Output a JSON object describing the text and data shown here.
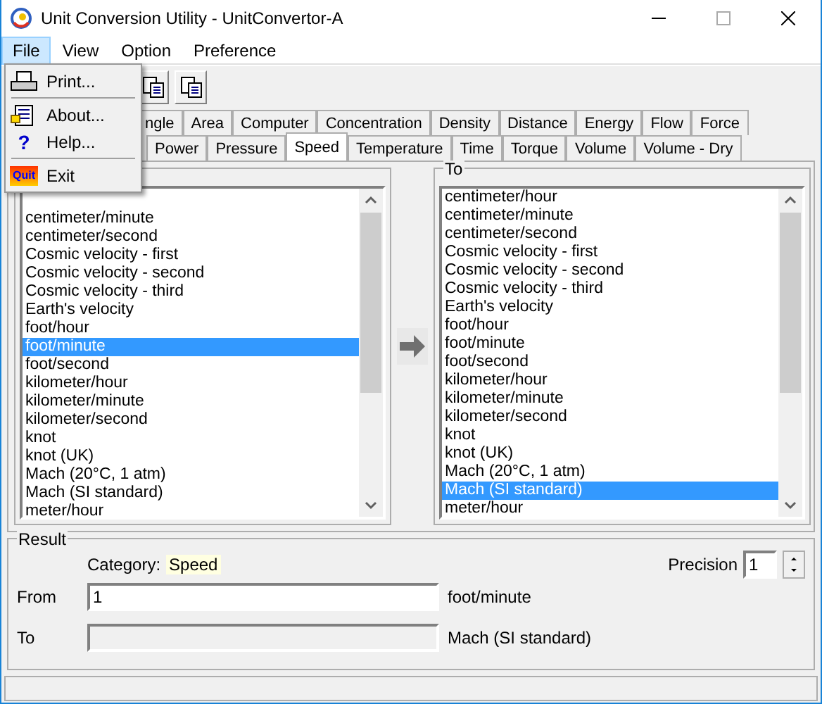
{
  "window": {
    "title": "Unit Conversion Utility - UnitConvertor-A"
  },
  "menu": [
    {
      "label": "File",
      "selected": true
    },
    {
      "label": "View",
      "selected": false
    },
    {
      "label": "Option",
      "selected": false
    },
    {
      "label": "Preference",
      "selected": false
    }
  ],
  "file_menu": [
    {
      "kind": "print",
      "label": "Print..."
    },
    {
      "kind": "separator"
    },
    {
      "kind": "about",
      "label": "About..."
    },
    {
      "kind": "help",
      "label": "Help...",
      "glyph": "?"
    },
    {
      "kind": "separator"
    },
    {
      "kind": "exit",
      "label": "Exit",
      "glyph": "Quit"
    }
  ],
  "tabs_back": [
    {
      "label": "ngle",
      "selected": false
    },
    {
      "label": "Area",
      "selected": false
    },
    {
      "label": "Computer",
      "selected": false
    },
    {
      "label": "Concentration",
      "selected": false
    },
    {
      "label": "Density",
      "selected": false
    },
    {
      "label": "Distance",
      "selected": false
    },
    {
      "label": "Energy",
      "selected": false
    },
    {
      "label": "Flow",
      "selected": false
    },
    {
      "label": "Force",
      "selected": false
    }
  ],
  "tabs_front": [
    {
      "label": "Power",
      "selected": false
    },
    {
      "label": "Pressure",
      "selected": false
    },
    {
      "label": "Speed",
      "selected": true
    },
    {
      "label": "Temperature",
      "selected": false
    },
    {
      "label": "Time",
      "selected": false
    },
    {
      "label": "Torque",
      "selected": false
    },
    {
      "label": "Volume",
      "selected": false
    },
    {
      "label": "Volume - Dry",
      "selected": false
    }
  ],
  "from_list": {
    "items": [
      {
        "label": "centimeter/minute",
        "selected": false
      },
      {
        "label": "centimeter/second",
        "selected": false
      },
      {
        "label": "Cosmic velocity - first",
        "selected": false
      },
      {
        "label": "Cosmic velocity - second",
        "selected": false
      },
      {
        "label": "Cosmic velocity - third",
        "selected": false
      },
      {
        "label": "Earth's velocity",
        "selected": false
      },
      {
        "label": "foot/hour",
        "selected": false
      },
      {
        "label": "foot/minute",
        "selected": true
      },
      {
        "label": "foot/second",
        "selected": false
      },
      {
        "label": "kilometer/hour",
        "selected": false
      },
      {
        "label": "kilometer/minute",
        "selected": false
      },
      {
        "label": "kilometer/second",
        "selected": false
      },
      {
        "label": "knot",
        "selected": false
      },
      {
        "label": "knot (UK)",
        "selected": false
      },
      {
        "label": "Mach (20°C, 1 atm)",
        "selected": false
      },
      {
        "label": "Mach (SI standard)",
        "selected": false
      },
      {
        "label": "meter/hour",
        "selected": false
      }
    ]
  },
  "to_list": {
    "title": "To",
    "items": [
      {
        "label": "centimeter/hour",
        "selected": false
      },
      {
        "label": "centimeter/minute",
        "selected": false
      },
      {
        "label": "centimeter/second",
        "selected": false
      },
      {
        "label": "Cosmic velocity - first",
        "selected": false
      },
      {
        "label": "Cosmic velocity - second",
        "selected": false
      },
      {
        "label": "Cosmic velocity - third",
        "selected": false
      },
      {
        "label": "Earth's velocity",
        "selected": false
      },
      {
        "label": "foot/hour",
        "selected": false
      },
      {
        "label": "foot/minute",
        "selected": false
      },
      {
        "label": "foot/second",
        "selected": false
      },
      {
        "label": "kilometer/hour",
        "selected": false
      },
      {
        "label": "kilometer/minute",
        "selected": false
      },
      {
        "label": "kilometer/second",
        "selected": false
      },
      {
        "label": "knot",
        "selected": false
      },
      {
        "label": "knot (UK)",
        "selected": false
      },
      {
        "label": "Mach (20°C, 1 atm)",
        "selected": false
      },
      {
        "label": "Mach (SI standard)",
        "selected": true
      },
      {
        "label": "meter/hour",
        "selected": false
      }
    ]
  },
  "result": {
    "title": "Result",
    "category_label": "Category:",
    "category": "Speed",
    "precision_label": "Precision",
    "precision": "1",
    "from_label": "From",
    "from_value": "1",
    "from_unit": "foot/minute",
    "to_label": "To",
    "to_unit": "Mach (SI standard)"
  }
}
